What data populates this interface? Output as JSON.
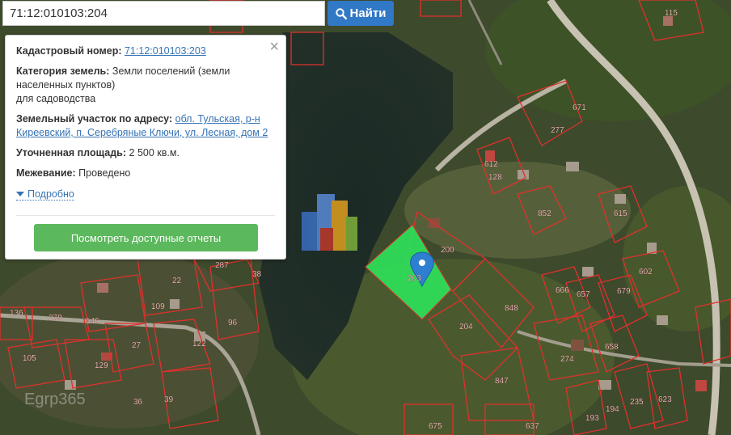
{
  "search": {
    "value": "71:12:010103:204",
    "button_label": "Найти",
    "icon": "search-icon"
  },
  "popup": {
    "cadastral_label": "Кадастровый номер:",
    "cadastral_value": "71:12:010103:203",
    "category_label": "Категория земель:",
    "category_value_1": "Земли поселений (земли",
    "category_value_2": "населенных пунктов)",
    "category_value_3": "для садоводства",
    "address_label": "Земельный участок по адресу:",
    "address_value_1": "обл. Тульская, р-н",
    "address_value_2": "Киреевский, п. Серебряные Ключи, ул. Лесная, дом 2",
    "area_label": "Уточненная площадь:",
    "area_value": "2 500 кв.м.",
    "survey_label": "Межевание:",
    "survey_value": "Проведено",
    "details_link": "Подробно",
    "reports_button": "Посмотреть доступные отчеты",
    "close_symbol": "×"
  },
  "map": {
    "selected_parcel_color": "#2ee05a",
    "boundary_color": "#e0302c",
    "labels": [
      "115",
      "671",
      "277",
      "612",
      "128",
      "852",
      "615",
      "602",
      "666",
      "657",
      "679",
      "848",
      "200",
      "203",
      "204",
      "274",
      "658",
      "847",
      "623",
      "235",
      "194",
      "193",
      "637",
      "675",
      "287",
      "22",
      "109",
      "38",
      "136",
      "279",
      "146",
      "105",
      "129",
      "27",
      "122",
      "96",
      "39",
      "36"
    ],
    "watermark": "Egrp365"
  }
}
